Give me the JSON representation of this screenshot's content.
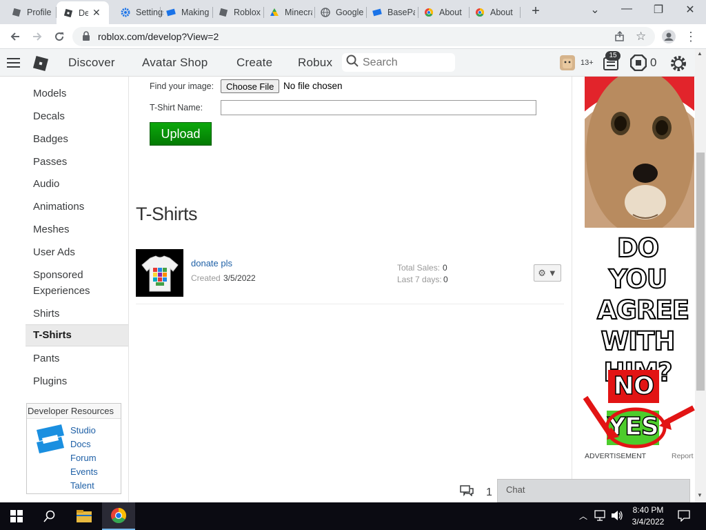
{
  "browser": {
    "tabs": [
      {
        "label": "Profile",
        "icon": "roblox-icon"
      },
      {
        "label": "Develop",
        "icon": "roblox-icon",
        "active": true
      },
      {
        "label": "Settings",
        "icon": "settings-gear-icon"
      },
      {
        "label": "Making",
        "icon": "roblox-studio-icon"
      },
      {
        "label": "Roblox",
        "icon": "roblox-icon"
      },
      {
        "label": "Minecraft",
        "icon": "google-drive-icon"
      },
      {
        "label": "Google",
        "icon": "globe-icon"
      },
      {
        "label": "BasePart",
        "icon": "roblox-studio-icon"
      },
      {
        "label": "About",
        "icon": "chrome-icon"
      },
      {
        "label": "About",
        "icon": "chrome-icon"
      }
    ],
    "url": "roblox.com/develop?View=2"
  },
  "header": {
    "nav": [
      "Discover",
      "Avatar Shop",
      "Create",
      "Robux"
    ],
    "search_placeholder": "Search",
    "age_badge": "13+",
    "notifications": "15",
    "robux": "0"
  },
  "sidebar": {
    "items": [
      "Models",
      "Decals",
      "Badges",
      "Passes",
      "Audio",
      "Animations",
      "Meshes",
      "User Ads",
      "Sponsored Experiences",
      "Shirts",
      "T-Shirts",
      "Pants",
      "Plugins"
    ],
    "active": "T-Shirts",
    "dev_resources": {
      "title": "Developer Resources",
      "links": [
        "Studio",
        "Docs",
        "Forum",
        "Events",
        "Talent"
      ]
    }
  },
  "upload_form": {
    "find_image_label": "Find your image:",
    "choose_file_label": "Choose File",
    "no_file_text": "No file chosen",
    "name_label": "T-Shirt Name:",
    "name_value": "",
    "upload_label": "Upload"
  },
  "tshirts": {
    "title": "T-Shirts",
    "items": [
      {
        "name": "donate pls",
        "created_label": "Created",
        "created_date": "3/5/2022",
        "total_sales_label": "Total Sales:",
        "total_sales": "0",
        "last7_label": "Last 7 days:",
        "last7": "0"
      }
    ]
  },
  "ad": {
    "meme_lines": [
      "DO YOU",
      "AGREE",
      "WITH",
      "HIM?"
    ],
    "no": "NO",
    "yes": "YES",
    "advertisement_label": "ADVERTISEMENT",
    "report_label": "Report"
  },
  "chat": {
    "label": "Chat",
    "count": "1"
  },
  "taskbar": {
    "time": "8:40 PM",
    "date": "3/4/2022"
  },
  "colors": {
    "upload_green": "#0b9e0b",
    "link_blue": "#1d5fa6",
    "header_bg": "#f2f4f5"
  }
}
